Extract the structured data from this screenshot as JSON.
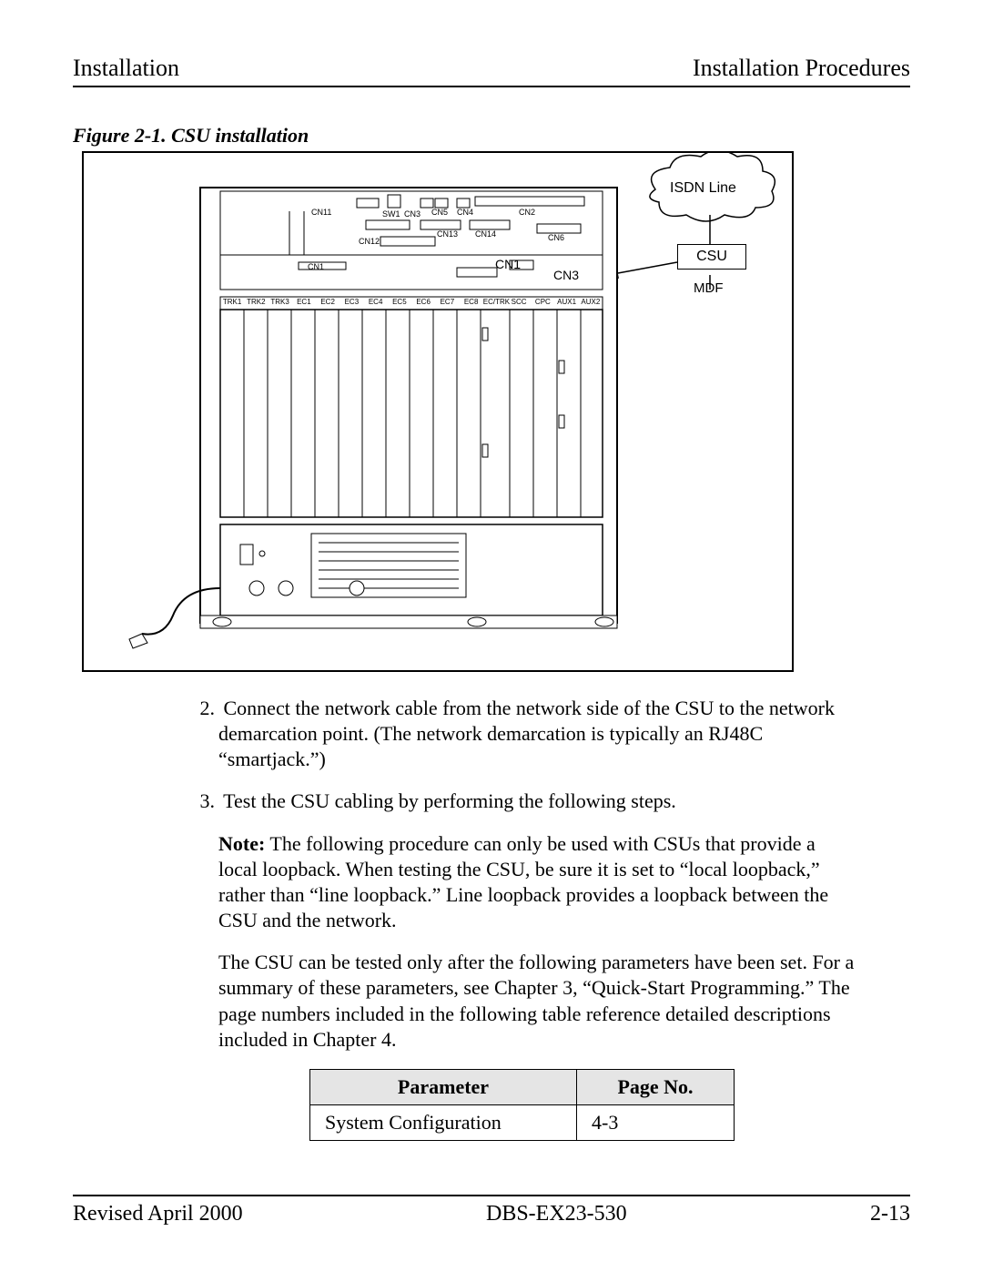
{
  "header": {
    "left": "Installation",
    "right": "Installation Procedures"
  },
  "figure": {
    "caption": "Figure 2-1. CSU installation",
    "labels": {
      "isdn": "ISDN  Line",
      "csu": "CSU",
      "mdf": "MDF",
      "cn11": "CN11",
      "sw1": "SW1",
      "cn3a": "CN3",
      "cn5": "CN5",
      "cn4": "CN4",
      "cn2": "CN2",
      "cn12": "CN12",
      "cn13": "CN13",
      "cn14": "CN14",
      "cn6": "CN6",
      "cn1a": "CN1",
      "cn1b": "CN1",
      "cn3b": "CN3"
    },
    "slots": [
      "TRK1",
      "TRK2",
      "TRK3",
      "EC1",
      "EC2",
      "EC3",
      "EC4",
      "EC5",
      "EC6",
      "EC7",
      "EC8",
      "EC/TRK",
      "SCC",
      "CPC",
      "AUX1",
      "AUX2"
    ]
  },
  "body": {
    "p1_num": "2.",
    "p1": "Connect the network cable from the network side of the CSU to the network demarcation point. (The network demarcation is typically an RJ48C “smartjack.”)",
    "p2_num": "3.",
    "p2": "Test the CSU cabling by performing the following steps.",
    "p3_bold": "Note:",
    "p3": " The following procedure can only be used with CSUs that provide a local loopback. When testing the CSU, be sure it is set to “local loopback,” rather than “line loopback.” Line loopback provides a loopback between the CSU and the network.",
    "p4": "The CSU can be tested only after the following parameters have been set. For a summary of these parameters, see Chapter 3, “Quick-Start Programming.” The page numbers included in the following table reference detailed descriptions included in Chapter 4."
  },
  "table": {
    "h1": "Parameter",
    "h2": "Page No.",
    "r1c1": "System Configuration",
    "r1c2": "4-3"
  },
  "footer": {
    "left": "Revised April 2000",
    "center": "DBS-EX23-530",
    "right": "2-13"
  }
}
